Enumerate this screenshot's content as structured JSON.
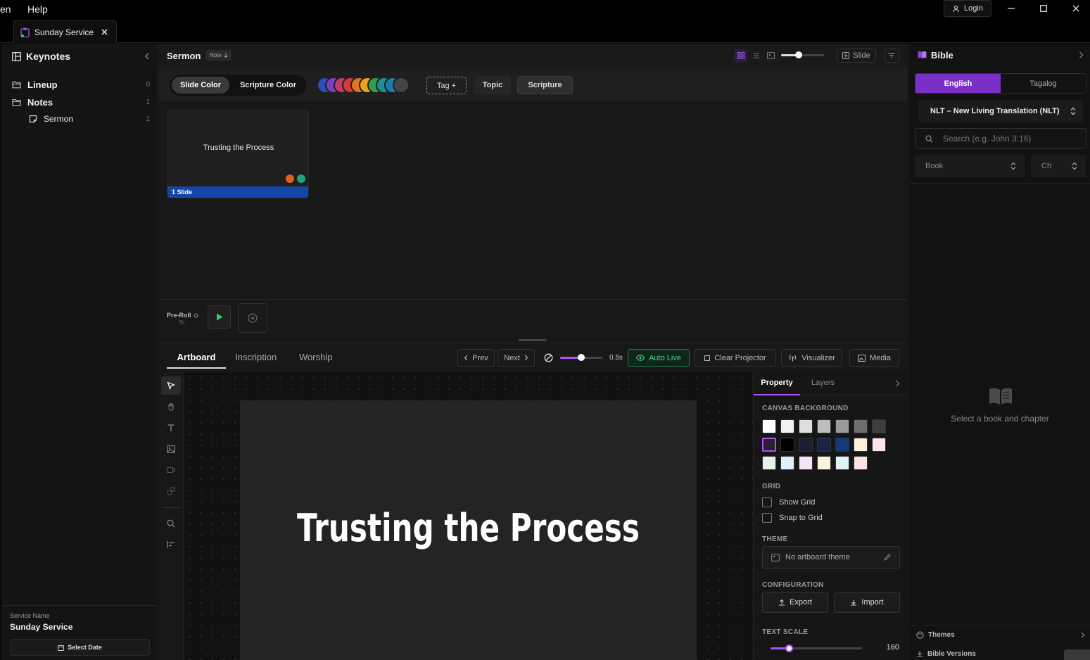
{
  "titlebar": {
    "menus": [
      "en",
      "Help"
    ],
    "login_label": "Login"
  },
  "tab": {
    "title": "Sunday Service"
  },
  "sidebar": {
    "title": "Keynotes",
    "items": [
      {
        "label": "Lineup",
        "count": "0"
      },
      {
        "label": "Notes",
        "count": "1"
      },
      {
        "label": "Sermon",
        "count": "1"
      }
    ],
    "service_name_label": "Service Name",
    "service_name": "Sunday Service",
    "select_date_label": "Select Date"
  },
  "center": {
    "header_title": "Sermon",
    "header_badge": "Note",
    "slide_button": "Slide",
    "chips": {
      "slide_color": "Slide Color",
      "scripture_color": "Scripture Color",
      "tag": "Tag +",
      "topic": "Topic",
      "scripture": "Scripture"
    },
    "palette": [
      "#2b4fb8",
      "#7b3fbf",
      "#c23a6a",
      "#d23b3b",
      "#e0731f",
      "#e8a317",
      "#2f9e4f",
      "#1f8f8f",
      "#1a7fa8",
      "#444444"
    ],
    "slide_card": {
      "title": "Trusting the Process",
      "footer": "1 Slide",
      "dots": [
        "#e0601f",
        "#1fa37a"
      ]
    },
    "preroll": {
      "label": "Pre-Roll",
      "value": "5s"
    },
    "editor_tabs": [
      "Artboard",
      "Inscription",
      "Worship"
    ],
    "controls": {
      "prev": "Prev",
      "next": "Next",
      "transition_value": "0.5s",
      "auto_live": "Auto Live",
      "clear_projector": "Clear Projector",
      "visualizer": "Visualizer",
      "media": "Media"
    },
    "artboard_text": "Trusting the Process"
  },
  "property_panel": {
    "tabs": [
      "Property",
      "Layers"
    ],
    "canvas_background_label": "CANVAS BACKGROUND",
    "swatches": [
      [
        "#ffffff",
        "#f2f2f2",
        "#dedede",
        "#bdbdbd",
        "#9a9a9a",
        "#6e6e6e",
        "#3e3e3e"
      ],
      [
        "#2a1f2e",
        "#000000",
        "#1c1f33",
        "#1a2344",
        "#143a7a",
        "#fdf1dd",
        "#fbe4ec"
      ],
      [
        "#e8f3e8",
        "#dff2fb",
        "#f4e6f7",
        "#fdf2dc",
        "#e0f3fc",
        "#fbe4e4"
      ]
    ],
    "grid_label": "GRID",
    "show_grid": "Show Grid",
    "snap_to_grid": "Snap to Grid",
    "theme_label": "THEME",
    "theme_value": "No artboard theme",
    "configuration_label": "CONFIGURATION",
    "export": "Export",
    "import": "Import",
    "text_scale_label": "TEXT SCALE",
    "text_scale_value": "160",
    "text_scale_fraction": 0.2
  },
  "bible": {
    "title": "Bible",
    "lang_tabs": [
      "English",
      "Tagalog"
    ],
    "translation": "NLT – New Living Translation (NLT)",
    "search_placeholder": "Search (e.g. John 3:16)",
    "book_label": "Book",
    "chapter_label": "Ch",
    "empty_message": "Select a book and chapter",
    "footer_items": [
      "Themes",
      "Bible Versions"
    ],
    "accent": "#7a2fc9"
  }
}
